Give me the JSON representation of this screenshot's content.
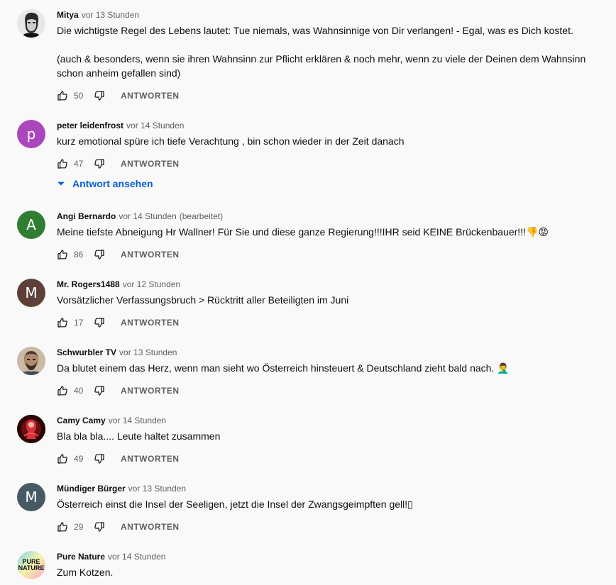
{
  "labels": {
    "reply": "ANTWORTEN",
    "view_replies": "Antwort ansehen"
  },
  "comments": [
    {
      "author": "Mitya",
      "time": "vor 13 Stunden",
      "edited": "",
      "avatar_letter": "",
      "avatar_color": "#e0e0e0",
      "paragraphs": [
        "Die  wichtigste Regel  des Lebens lautet:  Tue niemals, was Wahnsinnige von Dir verlangen!  - Egal, was es Dich kostet.",
        "(auch & besonders, wenn sie ihren Wahnsinn zur Pflicht erklären & noch mehr, wenn zu viele der Deinen dem Wahnsinn schon anheim gefallen sind)"
      ],
      "likes": "50"
    },
    {
      "author": "peter leidenfrost",
      "time": "vor 14 Stunden",
      "edited": "",
      "avatar_letter": "p",
      "avatar_color": "#ab47bc",
      "paragraphs": [
        "kurz emotional spüre ich tiefe Verachtung , bin schon wieder in der Zeit danach"
      ],
      "likes": "47"
    },
    {
      "author": "Angi Bernardo",
      "time": "vor 14 Stunden",
      "edited": "(bearbeitet)",
      "avatar_letter": "A",
      "avatar_color": "#2e7d32",
      "paragraphs": [
        "Meine tiefste Abneigung Hr Wallner! Für Sie und diese ganze Regierung!!!IHR seid KEINE Brückenbauer!!!👎😡"
      ],
      "likes": "86"
    },
    {
      "author": "Mr. Rogers1488",
      "time": "vor 12 Stunden",
      "edited": "",
      "avatar_letter": "M",
      "avatar_color": "#5d4037",
      "paragraphs": [
        "Vorsätzlicher Verfassungsbruch > Rücktritt aller Beteiligten im Juni"
      ],
      "likes": "17"
    },
    {
      "author": "Schwurbler TV",
      "time": "vor 13 Stunden",
      "edited": "",
      "avatar_letter": "",
      "avatar_color": "#8d7b6a",
      "paragraphs": [
        "Da blutet einem das Herz, wenn man sieht wo Österreich hinsteuert  & Deutschland zieht bald nach. 🤦‍♂️"
      ],
      "likes": "40"
    },
    {
      "author": "Camy Camy",
      "time": "vor 14 Stunden",
      "edited": "",
      "avatar_letter": "",
      "avatar_color": "#3a0a0a",
      "paragraphs": [
        "Bla bla bla.... Leute haltet zusammen"
      ],
      "likes": "49"
    },
    {
      "author": "Mündiger Bürger",
      "time": "vor 13 Stunden",
      "edited": "",
      "avatar_letter": "M",
      "avatar_color": "#455a64",
      "paragraphs": [
        "Österreich einst die Insel der Seeligen, jetzt die Insel der Zwangsgeimpften gell!▯"
      ],
      "likes": "29"
    },
    {
      "author": "Pure Nature",
      "time": "vor 14 Stunden",
      "edited": "",
      "avatar_letter": "",
      "avatar_color": "#ffffff",
      "avatar_logo": [
        "PURE",
        "NATURE"
      ],
      "paragraphs": [
        "Zum Kotzen."
      ],
      "likes": ""
    }
  ]
}
